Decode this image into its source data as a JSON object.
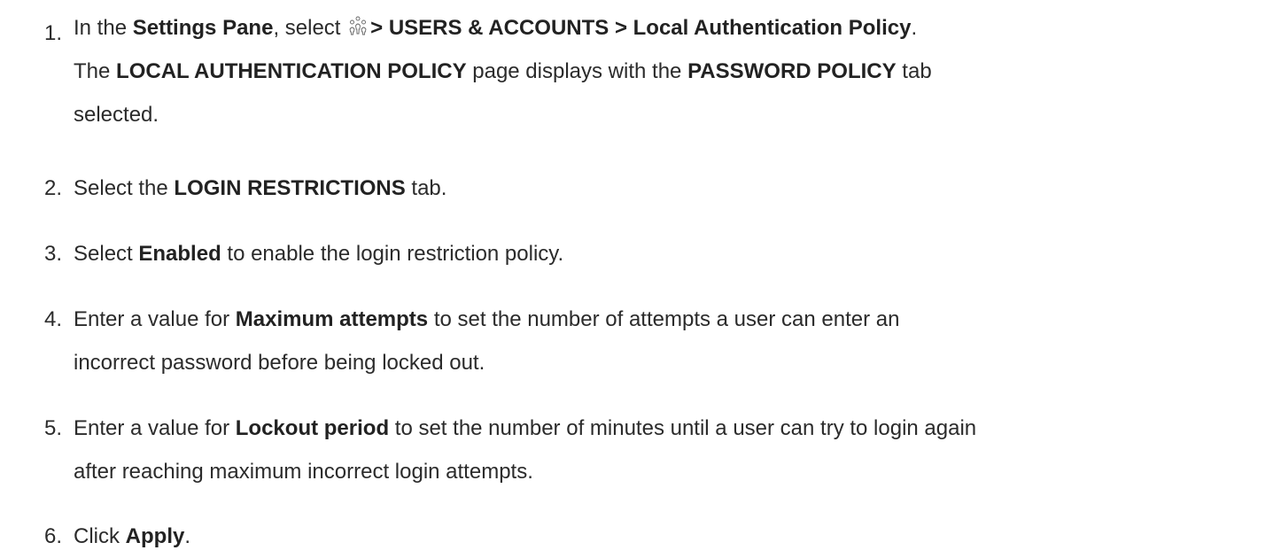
{
  "steps": [
    {
      "number": "1.",
      "lines": [
        {
          "t1": "In the ",
          "b1": "Settings Pane",
          "t2": ", select ",
          "icon": "users-icon",
          "b2": "> USERS & ACCOUNTS > Local Authentication Policy",
          "t3": "."
        },
        {
          "t1": "The ",
          "b1": "LOCAL AUTHENTICATION POLICY",
          "t2": " page displays with the ",
          "b2": "PASSWORD POLICY",
          "t3": " tab"
        },
        {
          "t1": "selected."
        }
      ]
    },
    {
      "number": "2.",
      "t1": "Select the ",
      "b1": "LOGIN RESTRICTIONS",
      "t2": " tab."
    },
    {
      "number": "3.",
      "t1": "Select ",
      "b1": "Enabled",
      "t2": " to enable the login restriction policy."
    },
    {
      "number": "4.",
      "line1": {
        "t1": "Enter a value for ",
        "b1": "Maximum attempts",
        "t2": " to set the number of attempts a user can enter an"
      },
      "line2": "incorrect password before being locked out."
    },
    {
      "number": "5.",
      "line1": {
        "t1": "Enter a value for ",
        "b1": "Lockout period",
        "t2": " to set the number of minutes until a user can try to login again"
      },
      "line2": "after reaching maximum incorrect login attempts."
    },
    {
      "number": "6.",
      "t1": "Click ",
      "b1": "Apply",
      "t2": "."
    }
  ]
}
